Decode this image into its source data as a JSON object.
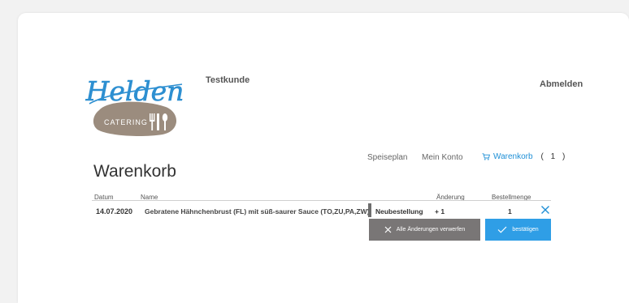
{
  "header": {
    "customer_name": "Testkunde",
    "logout_label": "Abmelden",
    "logo_script": "Helden",
    "logo_sub": "CATERING"
  },
  "nav": {
    "plan_label": "Speiseplan",
    "account_label": "Mein Konto",
    "cart_label": "Warenkorb",
    "cart_count": "( 1 )"
  },
  "page": {
    "title": "Warenkorb"
  },
  "table": {
    "headers": {
      "date": "Datum",
      "name": "Name",
      "change": "Änderung",
      "quantity": "Bestellmenge"
    },
    "rows": [
      {
        "date": "14.07.2020",
        "name": "Gebratene Hähnchenbrust (FL) mit süß-saurer Sauce (TO,ZU,PA,ZW),",
        "status": "Neubestellung",
        "change": "+ 1",
        "quantity": "1"
      }
    ]
  },
  "actions": {
    "discard_label": "Alle Änderungen verwerfen",
    "confirm_label": "bestätigen"
  },
  "colors": {
    "accent": "#2f9ee6",
    "cart_link": "#1e8fd6",
    "discard_button": "#797676",
    "logo_blob": "#9b8c7e"
  }
}
